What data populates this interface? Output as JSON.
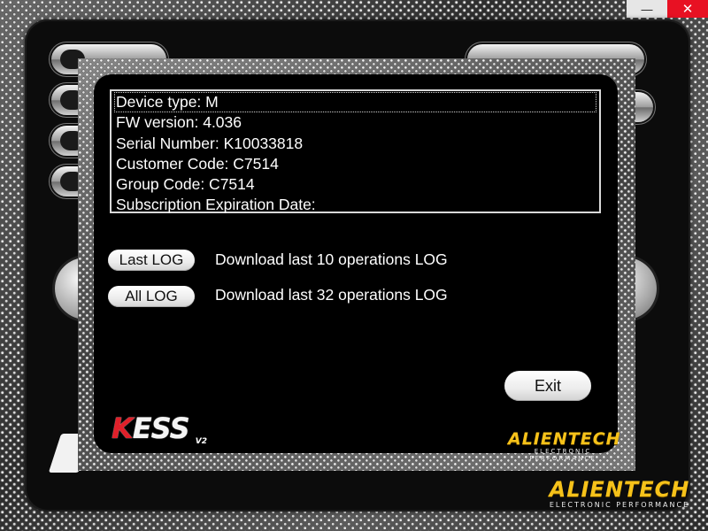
{
  "window": {
    "minimize_glyph": "—",
    "close_glyph": "✕"
  },
  "device_info": [
    "Device type: M",
    "FW version: 4.036",
    "Serial Number: K10033818",
    "Customer Code: C7514",
    "Group Code: C7514",
    "Subscription Expiration Date:"
  ],
  "log_actions": {
    "last_label": "Last LOG",
    "last_desc": "Download last 10 operations LOG",
    "all_label": "All LOG",
    "all_desc": "Download last 32 operations LOG"
  },
  "exit_label": "Exit",
  "logos": {
    "kess_text": "ESS",
    "kess_k": "K",
    "kess_version": "V2",
    "alientech_name": "ALIENTECH",
    "alientech_sub": "ELECTRONIC PERFORMANCE"
  },
  "colors": {
    "accent_gold": "#f6c21a",
    "kess_red": "#e0202a",
    "background": "#000000"
  }
}
